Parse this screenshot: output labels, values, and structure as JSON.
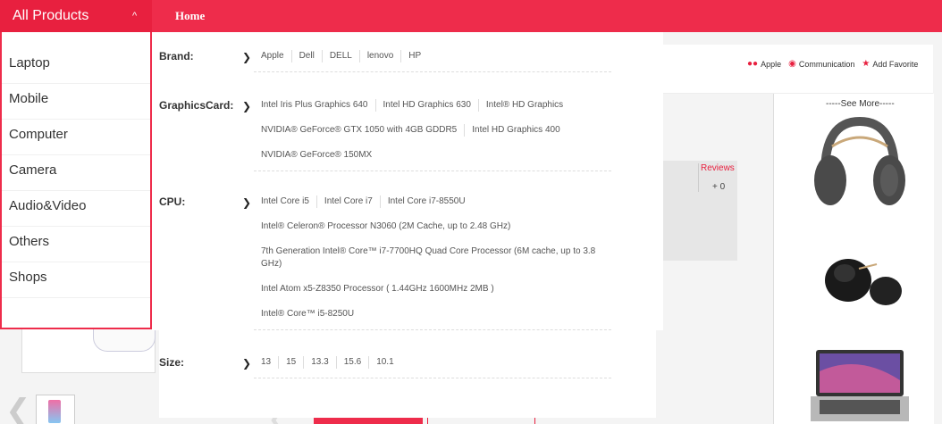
{
  "topbar": {
    "all_products_label": "All Products",
    "home_label": "Home"
  },
  "categories": [
    "Laptop",
    "Mobile",
    "Computer",
    "Camera",
    "Audio&Video",
    "Others",
    "Shops"
  ],
  "filters": {
    "brand": {
      "label": "Brand:",
      "lines": [
        [
          "Apple",
          "Dell",
          "DELL",
          "lenovo",
          "HP"
        ]
      ]
    },
    "graphics": {
      "label": "GraphicsCard:",
      "lines": [
        [
          "Intel Iris Plus Graphics 640",
          "Intel HD Graphics 630",
          "Intel® HD Graphics"
        ],
        [
          "NVIDIA® GeForce® GTX 1050 with 4GB GDDR5",
          "Intel HD Graphics 400"
        ],
        [
          "NVIDIA® GeForce® 150MX"
        ]
      ]
    },
    "cpu": {
      "label": "CPU:",
      "lines": [
        [
          "Intel Core i5",
          "Intel Core i7",
          "Intel Core i7-8550U"
        ],
        [
          "Intel® Celeron® Processor N3060 (2M Cache, up to 2.48 GHz)"
        ],
        [
          "7th Generation Intel® Core™ i7-7700HQ Quad Core Processor (6M cache, up to 3.8 GHz)"
        ],
        [
          "Intel Atom x5-Z8350 Processor ( 1.44GHz 1600MHz 2MB )"
        ],
        [
          "Intel® Core™ i5-8250U"
        ]
      ]
    },
    "size": {
      "label": "Size:",
      "lines": [
        [
          "13",
          "15",
          "13.3",
          "15.6",
          "10.1"
        ]
      ]
    }
  },
  "page": {
    "brand_link": "Apple",
    "communication_link": "Communication",
    "add_favorite_link": "Add Favorite",
    "reviews_label": "Reviews",
    "reviews_count": "+ 0",
    "see_more_label": "-----See More-----"
  },
  "icons": {
    "people": "people-icon",
    "chat": "chat-icon",
    "star": "star-icon",
    "caret": "caret-up-icon",
    "arrow": "chevron-right-icon"
  },
  "colors": {
    "brand_red": "#ee2c4b"
  }
}
